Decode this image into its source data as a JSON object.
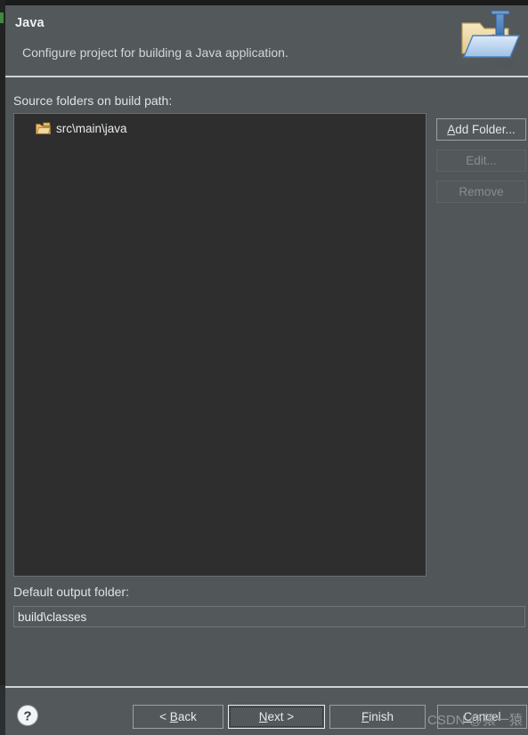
{
  "window": {
    "title": "Java",
    "description": "Configure project for building a Java application.",
    "header_icon": "java-project-folder-icon"
  },
  "source_section": {
    "label": "Source folders on build path:",
    "tree_items": [
      {
        "label": "src\\main\\java",
        "icon": "source-folder-icon"
      }
    ],
    "buttons": [
      {
        "id": "add-folder",
        "label": "Add Folder...",
        "mnemonic": "A",
        "enabled": true
      },
      {
        "id": "edit",
        "label": "Edit...",
        "mnemonic": "",
        "enabled": false
      },
      {
        "id": "remove",
        "label": "Remove",
        "mnemonic": "",
        "enabled": false
      }
    ]
  },
  "output_section": {
    "label": "Default output folder:",
    "value": "build\\classes",
    "placeholder": ""
  },
  "bottom_bar": {
    "help_icon": "question-mark-help-icon",
    "buttons": [
      {
        "id": "back",
        "label": "< Back",
        "mnemonic": "B",
        "enabled": true,
        "focused": false
      },
      {
        "id": "next",
        "label": "Next >",
        "mnemonic": "N",
        "enabled": true,
        "focused": true
      },
      {
        "id": "finish",
        "label": "Finish",
        "mnemonic": "F",
        "enabled": true,
        "focused": false
      },
      {
        "id": "cancel",
        "label": "Cancel",
        "mnemonic": "C",
        "enabled": true,
        "focused": false
      }
    ]
  },
  "watermark": {
    "text": "CSDN @猿一猿"
  },
  "colors": {
    "dialog_background": "#515659",
    "header_background": "#53585b",
    "tree_background": "#2e2e2e",
    "text_primary": "#e4e7e9",
    "text_disabled": "#878d90",
    "separator": "#cfd4d6",
    "folder_icon": "#e8b96a",
    "java_icon_blue": "#4a7fc1"
  }
}
